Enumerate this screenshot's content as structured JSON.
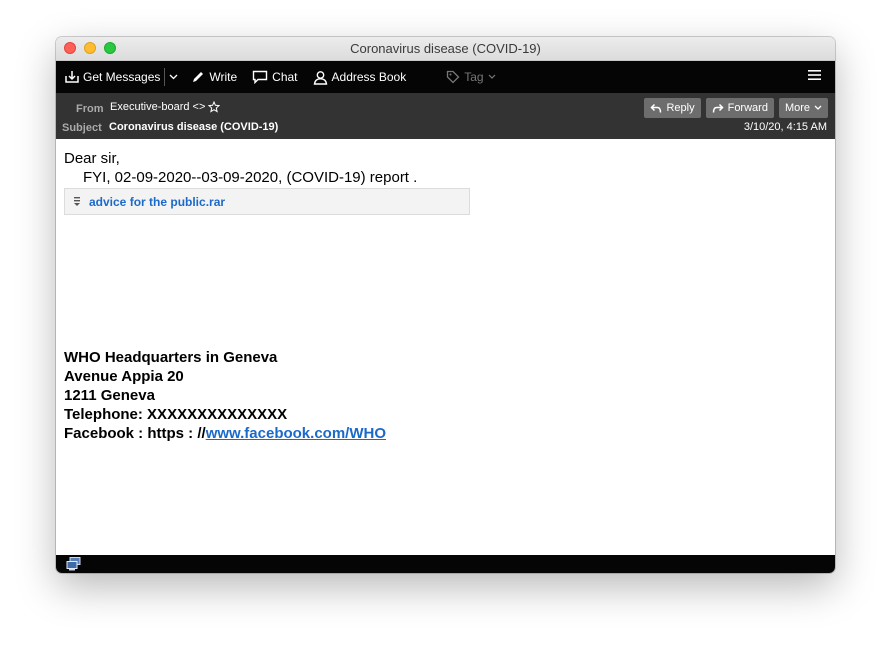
{
  "window": {
    "title": "Coronavirus disease (COVID-19)"
  },
  "toolbar": {
    "get_messages": "Get Messages",
    "write": "Write",
    "chat": "Chat",
    "address_book": "Address Book",
    "tag": "Tag"
  },
  "header": {
    "from_label": "From",
    "from_value": "Executive-board <>",
    "subject_label": "Subject",
    "subject_value": "Coronavirus disease (COVID-19)",
    "date": "3/10/20, 4:15 AM",
    "reply": "Reply",
    "forward": "Forward",
    "more": "More"
  },
  "message": {
    "greeting": "Dear sir,",
    "line": "FYI, 02-09-2020--03-09-2020, (COVID-19) report ."
  },
  "attachment": {
    "name": "advice for the public.rar"
  },
  "signature": {
    "line1": "WHO Headquarters in Geneva",
    "line2": "Avenue Appia 20",
    "line3": "1211 Geneva",
    "line4": "Telephone: XXXXXXXXXXXXXX",
    "facebook_prefix": "Facebook : https : //",
    "facebook_link": "www.facebook.com/WHO"
  },
  "colors": {
    "toolbar_bg": "#050505",
    "header_bg": "#333334",
    "link": "#1b6ac9"
  }
}
